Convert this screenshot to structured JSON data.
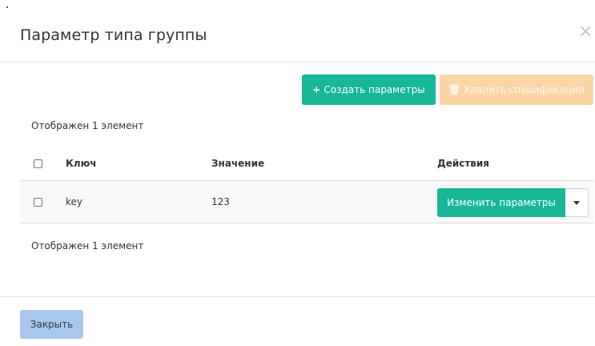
{
  "dialog": {
    "title": "Параметр типа группы",
    "close_symbol": "×"
  },
  "toolbar": {
    "create_icon": "plus-icon",
    "create_icon_glyph": "+",
    "create_label": "Создать параметры",
    "delete_icon": "trash-icon",
    "delete_icon_glyph": "🗑",
    "delete_label": "Удалить спецификации"
  },
  "summary": {
    "top": "Отображен 1 элемент",
    "bottom": "Отображен 1 элемент"
  },
  "table": {
    "headers": {
      "key": "Ключ",
      "value": "Значение",
      "actions": "Действия"
    },
    "rows": [
      {
        "key": "key",
        "value": "123",
        "action_label": "Изменить параметры"
      }
    ]
  },
  "footer": {
    "close_label": "Закрыть"
  },
  "colors": {
    "primary": "#17b797",
    "danger_disabled": "#fbd5a6",
    "footer_button": "#a9c6ec"
  }
}
